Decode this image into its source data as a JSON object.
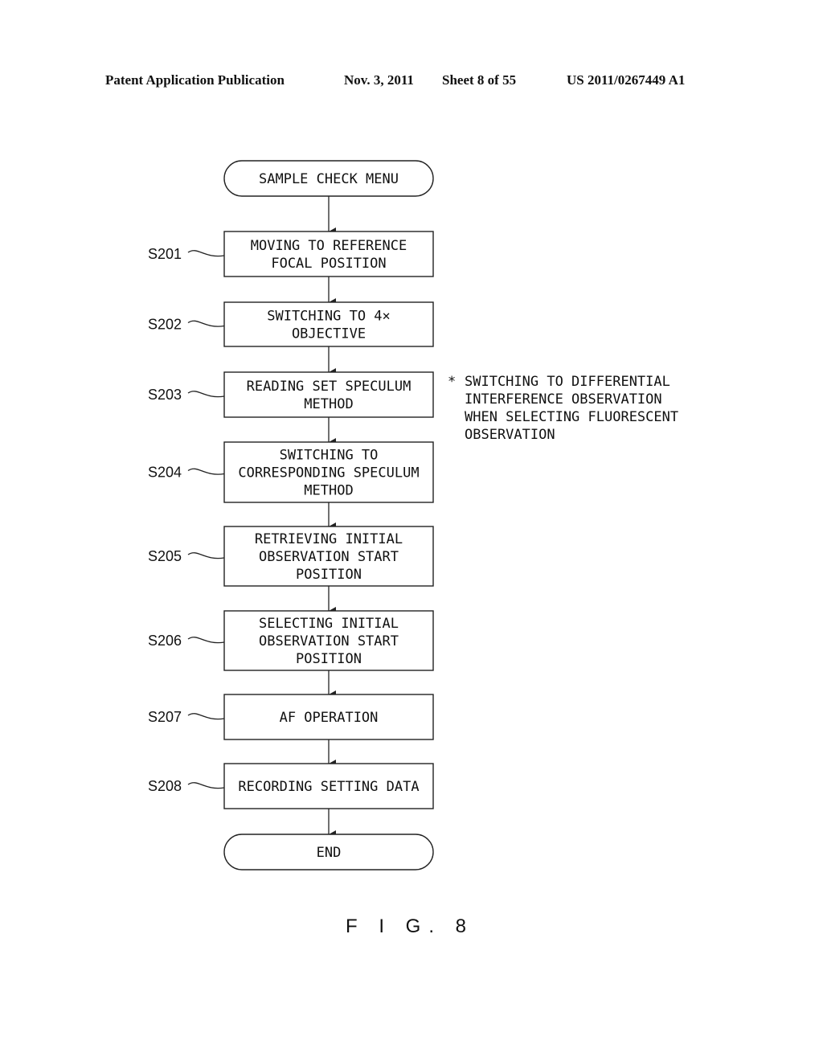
{
  "header": {
    "publication": "Patent Application Publication",
    "date": "Nov. 3, 2011",
    "sheet": "Sheet 8 of 55",
    "number": "US 2011/0267449 A1"
  },
  "flowchart": {
    "start": {
      "lines": [
        "SAMPLE CHECK MENU"
      ]
    },
    "steps": [
      {
        "id": "S201",
        "lines": [
          "MOVING TO REFERENCE",
          "FOCAL POSITION"
        ]
      },
      {
        "id": "S202",
        "lines": [
          "SWITCHING TO 4×",
          "OBJECTIVE"
        ]
      },
      {
        "id": "S203",
        "lines": [
          "READING SET SPECULUM",
          "METHOD"
        ]
      },
      {
        "id": "S204",
        "lines": [
          "SWITCHING TO",
          "CORRESPONDING SPECULUM",
          "METHOD"
        ]
      },
      {
        "id": "S205",
        "lines": [
          "RETRIEVING INITIAL",
          "OBSERVATION START",
          "POSITION"
        ]
      },
      {
        "id": "S206",
        "lines": [
          "SELECTING INITIAL",
          "OBSERVATION START",
          "POSITION"
        ]
      },
      {
        "id": "S207",
        "lines": [
          "AF OPERATION"
        ]
      },
      {
        "id": "S208",
        "lines": [
          "RECORDING SETTING DATA"
        ]
      }
    ],
    "end": {
      "lines": [
        "END"
      ]
    },
    "note": {
      "marker": "*",
      "lines": [
        "SWITCHING TO DIFFERENTIAL",
        "INTERFERENCE OBSERVATION",
        "WHEN SELECTING FLUORESCENT",
        "OBSERVATION"
      ]
    }
  },
  "figure_label": "F I G. 8"
}
